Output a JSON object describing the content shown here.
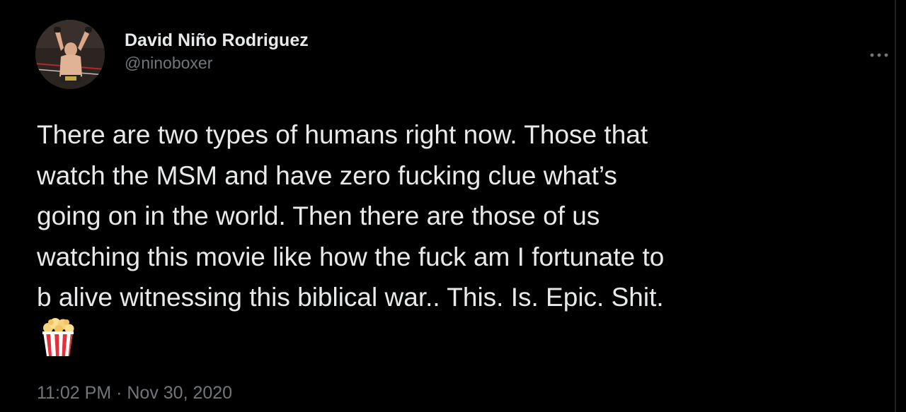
{
  "author": {
    "display_name": "David Niño Rodriguez",
    "handle": "@ninoboxer"
  },
  "tweet": {
    "lines": [
      "There are two types of humans right now. Those that",
      "watch the MSM and have zero fucking clue what’s",
      "going on in the world. Then there are those of us",
      "watching this movie like how the fuck am I fortunate to",
      "b alive witnessing this biblical war.. This. Is. Epic. Shit."
    ],
    "emoji": "popcorn-icon",
    "timestamp": "11:02 PM · Nov 30, 2020"
  },
  "icons": {
    "more": "more-options-icon"
  },
  "colors": {
    "background": "#000000",
    "primary_text": "#e7e9ea",
    "secondary_text": "#71767b"
  }
}
